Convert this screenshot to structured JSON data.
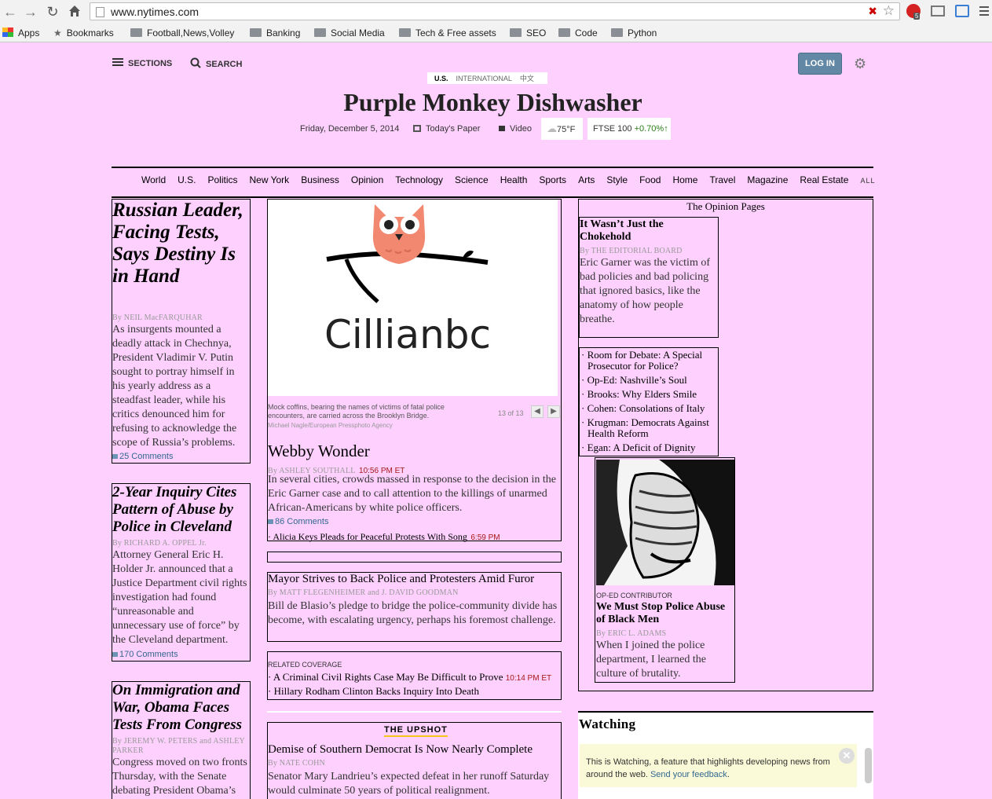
{
  "browser": {
    "url": "www.nytimes.com",
    "badge_count": "5"
  },
  "bookmarks": [
    "Apps",
    "Bookmarks",
    "Football,News,Volley",
    "Banking",
    "Social Media",
    "Tech & Free assets",
    "SEO",
    "Code",
    "Python"
  ],
  "masthead": {
    "sections": "SECTIONS",
    "search": "SEARCH",
    "login": "LOG IN",
    "ed_us": "U.S.",
    "ed_intl": "INTERNATIONAL",
    "ed_cn": "中文",
    "title": "Purple Monkey Dishwasher",
    "date": "Friday, December 5, 2014",
    "todays_paper": "Today's Paper",
    "video": "Video",
    "weather": "75°F",
    "market_name": "FTSE 100",
    "market_change": "+0.70%",
    "market_arrow": "↑"
  },
  "nav": [
    "World",
    "U.S.",
    "Politics",
    "New York",
    "Business",
    "Opinion",
    "Technology",
    "Science",
    "Health",
    "Sports",
    "Arts",
    "Style",
    "Food",
    "Home",
    "Travel",
    "Magazine",
    "Real Estate"
  ],
  "nav_all": "ALL",
  "left": [
    {
      "headline": "Russian Leader, Facing Tests, Says Destiny Is in Hand",
      "byline": "By NEIL MacFARQUHAR",
      "summary": "As insurgents mounted a deadly attack in Chechnya, President Vladimir V. Putin sought to portray himself in his yearly address as a steadfast leader, while his critics denounced him for refusing to acknowledge the scope of Russia’s problems.",
      "comments": "25 Comments"
    },
    {
      "headline": "2-Year Inquiry Cites Pattern of Abuse by Police in Cleveland",
      "byline": "By RICHARD A. OPPEL Jr.",
      "summary": "Attorney General Eric H. Holder Jr. announced that a Justice Department civil rights investigation had found “unreasonable and unnecessary use of force” by the Cleveland department.",
      "comments": "170 Comments"
    },
    {
      "headline": "On Immigration and War, Obama Faces Tests From Congress",
      "byline": "By JEREMY W. PETERS and ASHLEY PARKER",
      "summary": "Congress moved on two fronts Thursday, with the Senate debating President Obama’s"
    }
  ],
  "center": {
    "logo_text": "Cillianbc",
    "caption": "Mock coffins, bearing the names of victims of fatal police encounters, are carried across the Brooklyn Bridge.",
    "credit": "Michael Nagle/European Pressphoto Agency",
    "counter": "13 of 13",
    "story1": {
      "headline": "Webby Wonder",
      "byline": "By ASHLEY SOUTHALL",
      "time": "10:56 PM ET",
      "summary": "In several cities, crowds massed in response to the decision in the Eric Garner case and to call attention to the killings of unarmed African-Americans by white police officers.",
      "comments": "86 Comments",
      "related": "· Alicia Keys Pleads for Peaceful Protests With Song",
      "related_time": "6:59 PM"
    },
    "story2": {
      "headline": "Mayor Strives to Back Police and Protesters Amid Furor",
      "byline": "By MATT FLEGENHEIMER and J. DAVID GOODMAN",
      "summary": "Bill de Blasio’s pledge to bridge the police-community divide has become, with escalating urgency, perhaps his foremost challenge."
    },
    "related": {
      "label": "RELATED COVERAGE",
      "item1": "· A Criminal Civil Rights Case May Be Difficult to Prove",
      "item1_time": "10:14 PM ET",
      "item2": "· Hillary Rodham Clinton Backs Inquiry Into Death"
    },
    "upshot": {
      "label": "THE UPSHOT",
      "headline": "Demise of Southern Democrat Is Now Nearly Complete",
      "byline": "By NATE COHN",
      "summary": "Senator Mary Landrieu’s expected defeat in her runoff Saturday would culminate 50 years of political realignment."
    }
  },
  "opinion": {
    "label": "The Opinion Pages",
    "editorial": {
      "headline": "It Wasn’t Just the Chokehold",
      "byline": "By THE EDITORIAL BOARD",
      "summary": "Eric Garner was the victim of bad policies and bad policing that ignored basics, like the anatomy of how people breathe."
    },
    "list": [
      "· Room for Debate: A Special Prosecutor for Police?",
      "· Op-Ed: Nashville’s Soul",
      "· Brooks: Why Elders Smile",
      "· Cohen: Consolations of Italy",
      "· Krugman: Democrats Against Health Reform",
      "· Egan: A Deficit of Dignity"
    ],
    "oped": {
      "kicker": "OP-ED CONTRIBUTOR",
      "headline": "We Must Stop Police Abuse of Black Men",
      "byline": "By ERIC L. ADAMS",
      "summary": "When I joined the police department, I learned the culture of brutality."
    }
  },
  "watching": {
    "title": "Watching",
    "text": "This is Watching, a feature that highlights developing news from around the web.",
    "link": "Send your feedback",
    "link_end": "."
  }
}
